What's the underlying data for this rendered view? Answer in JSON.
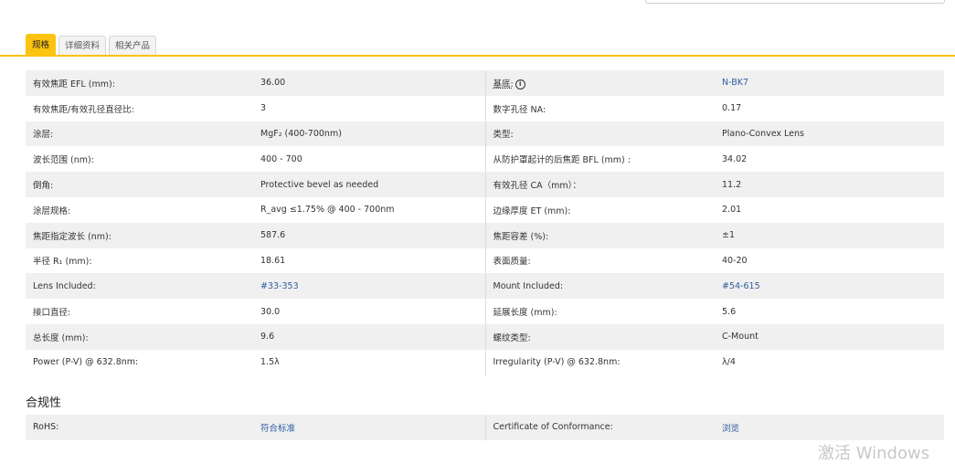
{
  "tabs": [
    {
      "label": "规格"
    },
    {
      "label": "详细资料"
    },
    {
      "label": "相关产品"
    }
  ],
  "spec_rows": [
    {
      "l1": "有效焦距 EFL (mm):",
      "v1": "36.00",
      "l2": "基底:",
      "v2": "N-BK7"
    },
    {
      "l1": "有效焦距/有效孔径直径比:",
      "v1": "3",
      "l2": "数字孔径 NA:",
      "v2": "0.17"
    },
    {
      "l1": "涂层:",
      "v1": "MgF₂ (400-700nm)",
      "l2": "类型:",
      "v2": "Plano-Convex Lens"
    },
    {
      "l1": "波长范围 (nm):",
      "v1": "400 - 700",
      "l2": "从防护罩起计的后焦距 BFL (mm) :",
      "v2": "34.02"
    },
    {
      "l1": "倒角:",
      "v1": "Protective bevel as needed",
      "l2": "有效孔径 CA（mm）：",
      "v2": "11.2"
    },
    {
      "l1": "涂层规格:",
      "v1": "R_avg ≤1.75% @ 400 - 700nm",
      "l2": "边缘厚度 ET (mm):",
      "v2": "2.01"
    },
    {
      "l1": "焦距指定波长 (nm):",
      "v1": "587.6",
      "l2": "焦距容差 (%):",
      "v2": "±1"
    },
    {
      "l1": "半径 R₁ (mm):",
      "v1": "18.61",
      "l2": "表面质量:",
      "v2": "40-20"
    },
    {
      "l1": "Lens Included:",
      "v1": "#33-353",
      "l2": "Mount Included:",
      "v2": "#54-615"
    },
    {
      "l1": "接口直径:",
      "v1": "30.0",
      "l2": "延展长度 (mm):",
      "v2": "5.6"
    },
    {
      "l1": "总长度 (mm):",
      "v1": "9.6",
      "l2": "螺纹类型:",
      "v2": "C-Mount"
    },
    {
      "l1": "Power (P-V) @ 632.8nm:",
      "v1": "1.5λ",
      "l2": "Irregularity (P-V) @ 632.8nm:",
      "v2": "λ/4"
    }
  ],
  "compliance": {
    "title": "合规性",
    "l1": "RoHS:",
    "v1": "符合标准",
    "l2": "Certificate of Conformance:",
    "v2": "浏览"
  },
  "watermark": "激活 Windows",
  "colors": {
    "accent": "#fcc30f",
    "link": "#2f5e9e",
    "row_shade": "#f0f0f0"
  }
}
